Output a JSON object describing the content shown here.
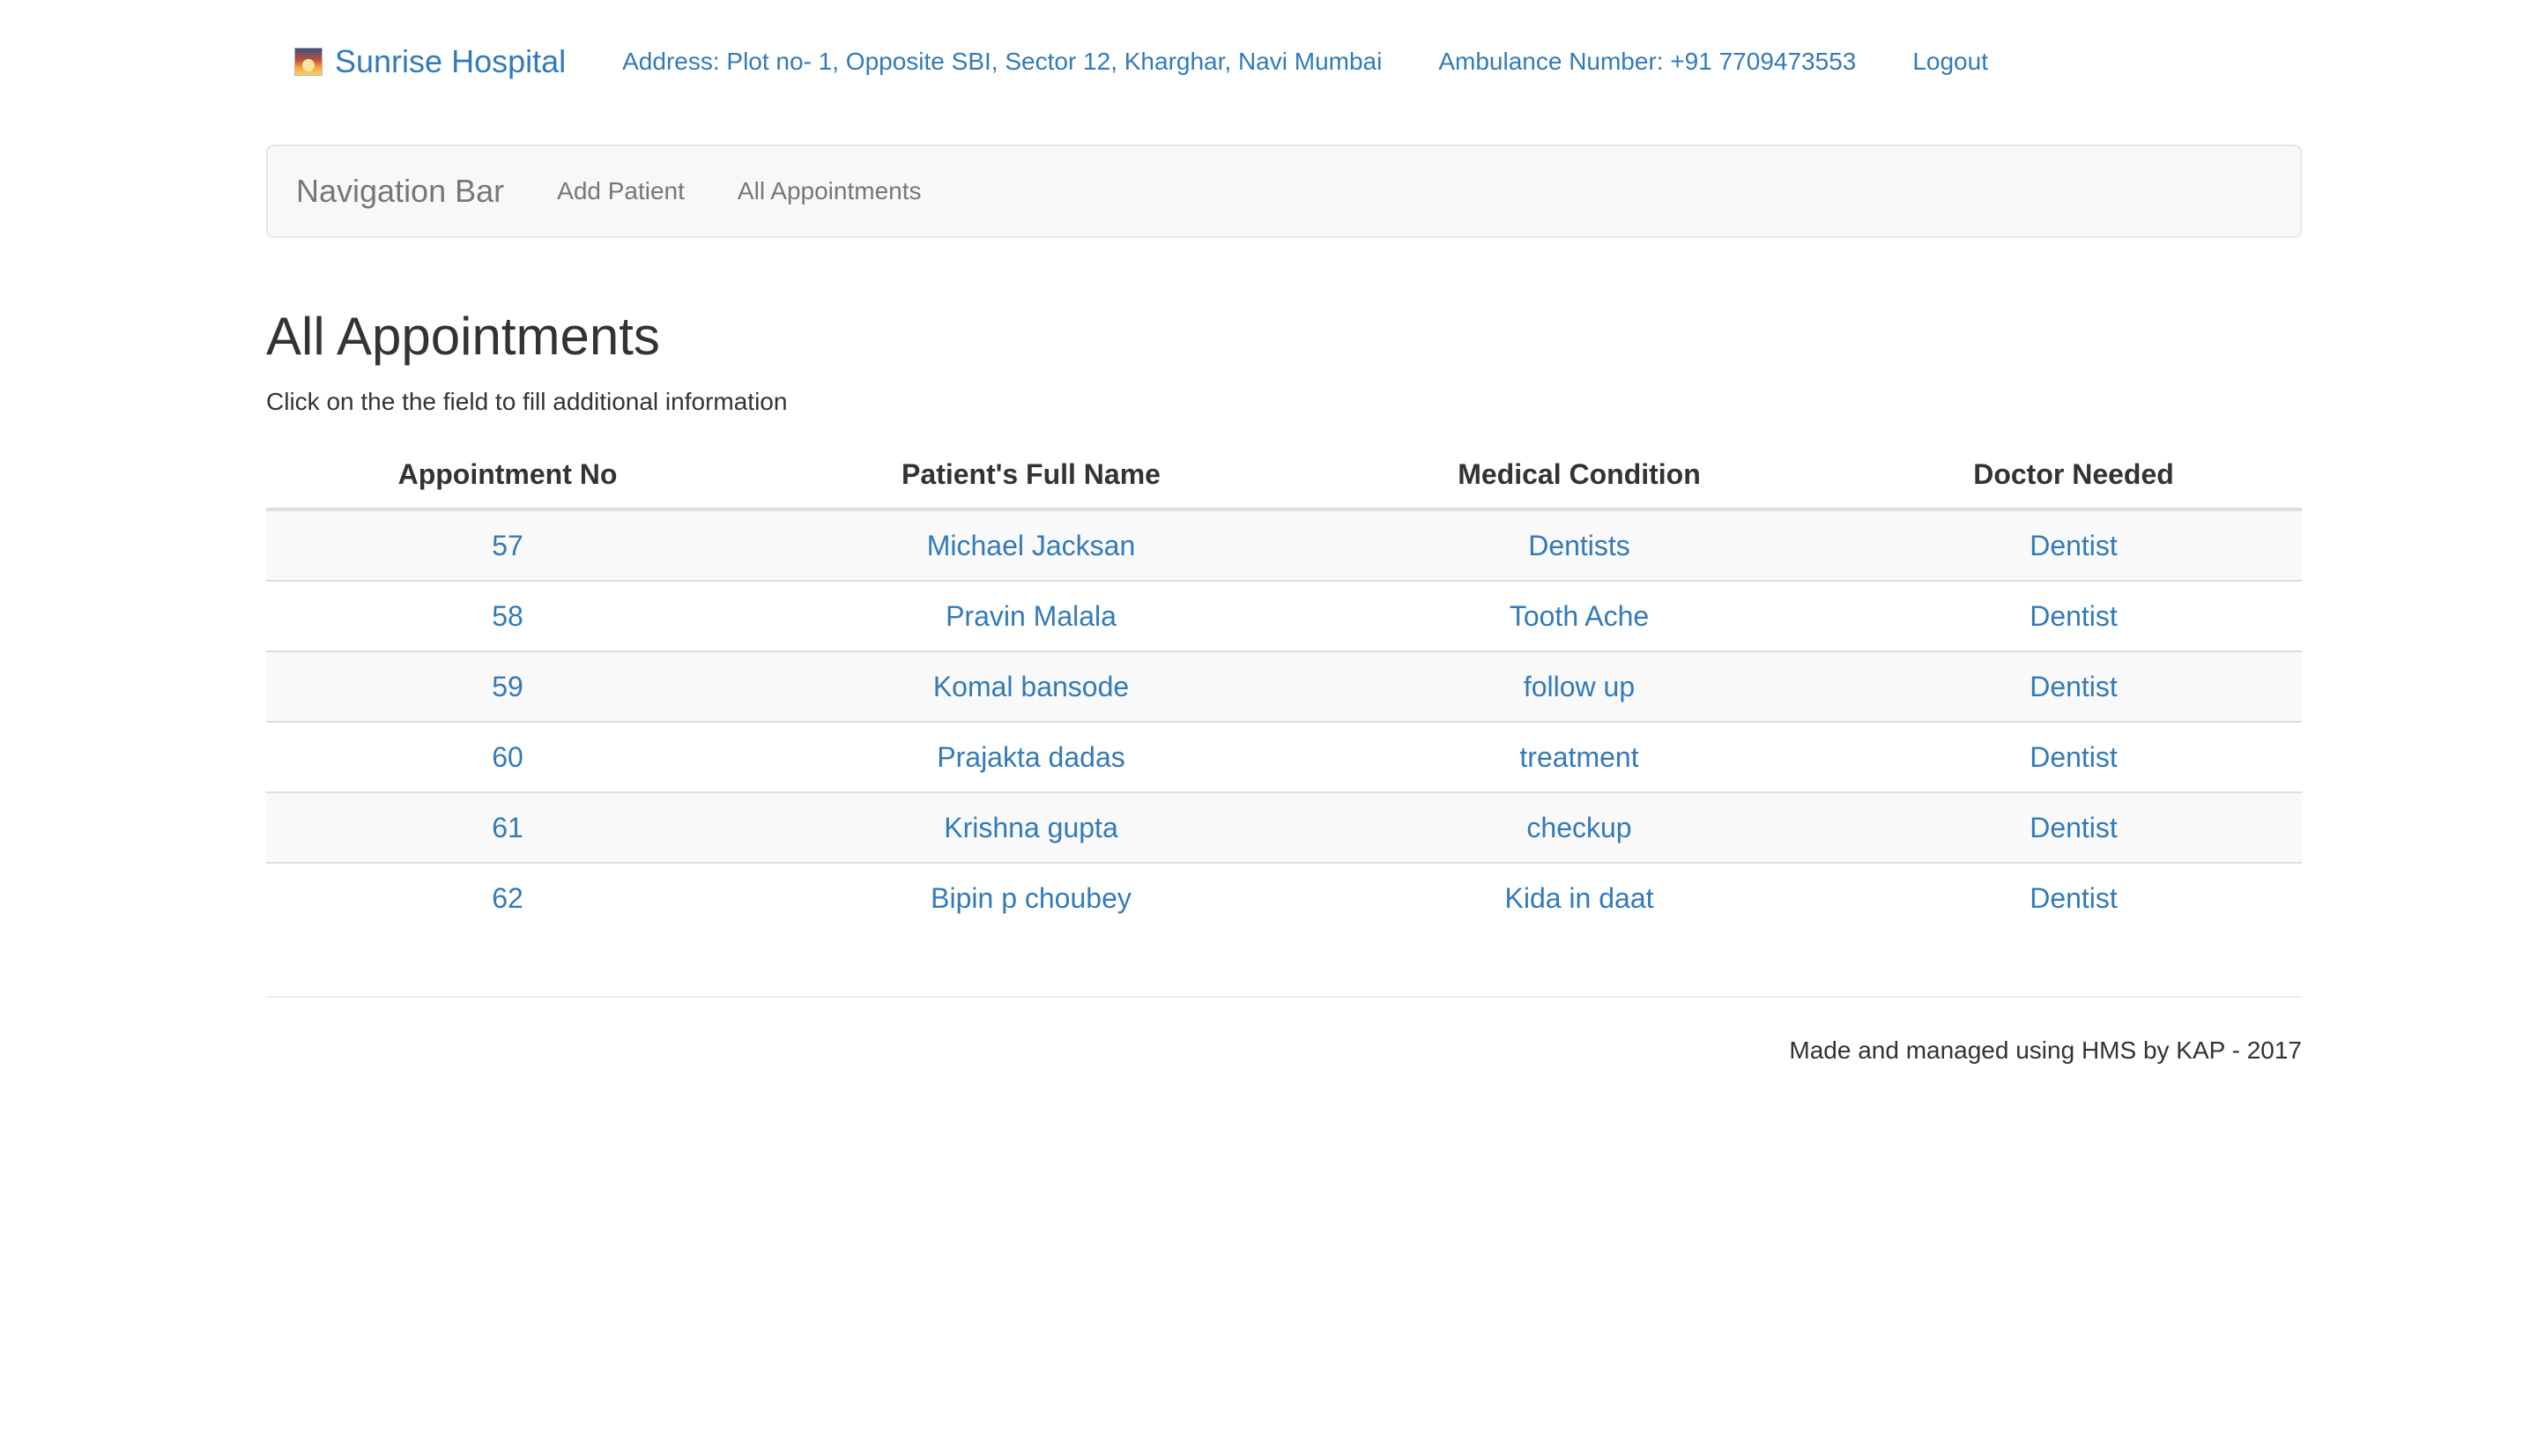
{
  "header": {
    "brand_name": "Sunrise Hospital",
    "brand_icon": "sunrise-logo-icon",
    "address": "Address: Plot no- 1, Opposite SBI, Sector 12, Kharghar, Navi Mumbai",
    "ambulance": "Ambulance Number: +91 7709473553",
    "logout": "Logout"
  },
  "navbar": {
    "brand": "Navigation Bar",
    "links": [
      "Add Patient",
      "All Appointments"
    ]
  },
  "main": {
    "title": "All Appointments",
    "subtitle": "Click on the the field to fill additional information"
  },
  "table": {
    "headers": [
      "Appointment No",
      "Patient's Full Name",
      "Medical Condition",
      "Doctor Needed"
    ],
    "rows": [
      [
        "57",
        "Michael Jacksan",
        "Dentists",
        "Dentist"
      ],
      [
        "58",
        "Pravin Malala",
        "Tooth Ache",
        "Dentist"
      ],
      [
        "59",
        "Komal bansode",
        "follow up",
        "Dentist"
      ],
      [
        "60",
        "Prajakta dadas",
        "treatment",
        "Dentist"
      ],
      [
        "61",
        "Krishna gupta",
        "checkup",
        "Dentist"
      ],
      [
        "62",
        "Bipin p choubey",
        "Kida in daat",
        "Dentist"
      ]
    ]
  },
  "footer": {
    "text": "Made and managed using HMS by KAP - 2017"
  },
  "colors": {
    "link": "#337ab7",
    "navbar_bg": "#f8f8f8",
    "striped_row": "#f9f9f9",
    "text": "#333333"
  }
}
